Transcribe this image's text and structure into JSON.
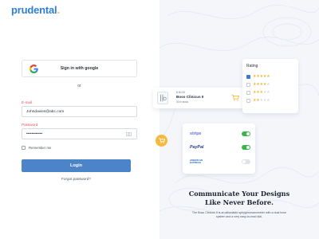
{
  "brand": {
    "name": "prudental",
    "dot": "."
  },
  "login": {
    "google_label": "Sign in with google",
    "or_text": "or",
    "email_label": "E-mail",
    "email_value": "Johndavies@abc.com",
    "password_label": "Password",
    "password_value": "••••••••••••",
    "remember_label": "Remember me",
    "login_label": "Login",
    "forgot_label": "Forgot password?"
  },
  "product_card": {
    "price": "$ 80.00",
    "name": "Boso Clinicus II",
    "stock": "30 in stock"
  },
  "rating_card": {
    "title": "Rating",
    "rows": [
      {
        "stars": 5,
        "checked": true
      },
      {
        "stars": 4,
        "checked": false
      },
      {
        "stars": 3,
        "checked": false
      },
      {
        "stars": 2,
        "checked": false
      }
    ]
  },
  "payments": [
    {
      "name": "stripe",
      "enabled": true
    },
    {
      "name": "PayPal",
      "enabled": true
    },
    {
      "name": "AMERICAN EXPRESS",
      "enabled": false
    }
  ],
  "promo": {
    "headline_line1": "Communicate Your Designs",
    "headline_line2": "Like Never Before.",
    "description": "The Boso Clinicus II is an affordable sphygmomanometer with a dual hose system and a very easy-to-read dial."
  },
  "colors": {
    "brand_blue": "#2f7fd2",
    "accent_yellow": "#f5b942",
    "login_button": "#4b84c9",
    "toggle_on": "#39b54a",
    "error_red": "#e0505a"
  }
}
